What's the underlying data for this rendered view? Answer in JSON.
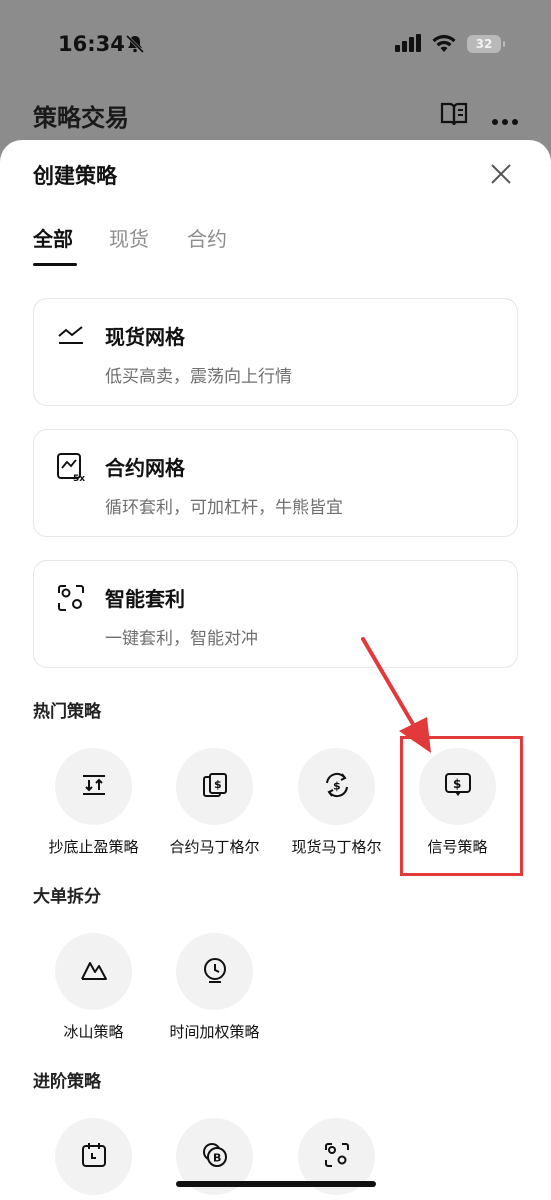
{
  "status_bar": {
    "time": "16:34",
    "battery": "32"
  },
  "background": {
    "header_title": "策略交易"
  },
  "sheet": {
    "title": "创建策略",
    "tabs": [
      {
        "label": "全部",
        "active": true
      },
      {
        "label": "现货",
        "active": false
      },
      {
        "label": "合约",
        "active": false
      }
    ],
    "cards": [
      {
        "title": "现货网格",
        "subtitle": "低买高卖，震荡向上行情",
        "icon": "spot-grid-icon"
      },
      {
        "title": "合约网格",
        "subtitle": "循环套利，可加杠杆，牛熊皆宜",
        "icon": "futures-grid-icon"
      },
      {
        "title": "智能套利",
        "subtitle": "一键套利，智能对冲",
        "icon": "smart-arbitrage-icon"
      }
    ],
    "sections": {
      "popular": {
        "title": "热门策略",
        "items": [
          {
            "label": "抄底止盈策略",
            "icon": "buy-dip-icon"
          },
          {
            "label": "合约马丁格尔",
            "icon": "futures-martingale-icon"
          },
          {
            "label": "现货马丁格尔",
            "icon": "spot-martingale-icon"
          },
          {
            "label": "信号策略",
            "icon": "signal-strategy-icon"
          }
        ]
      },
      "split": {
        "title": "大单拆分",
        "items": [
          {
            "label": "冰山策略",
            "icon": "iceberg-icon"
          },
          {
            "label": "时间加权策略",
            "icon": "twap-clock-icon"
          }
        ]
      },
      "advanced": {
        "title": "进阶策略",
        "items": [
          {
            "label": "",
            "icon": "calendar-clock-icon"
          },
          {
            "label": "",
            "icon": "coin-stack-icon"
          },
          {
            "label": "",
            "icon": "scan-arbitrage-icon"
          }
        ]
      }
    }
  },
  "colors": {
    "highlight": "#e23a3a",
    "overlay": "#8c8c8c",
    "circle_bg": "#f2f2f2"
  }
}
